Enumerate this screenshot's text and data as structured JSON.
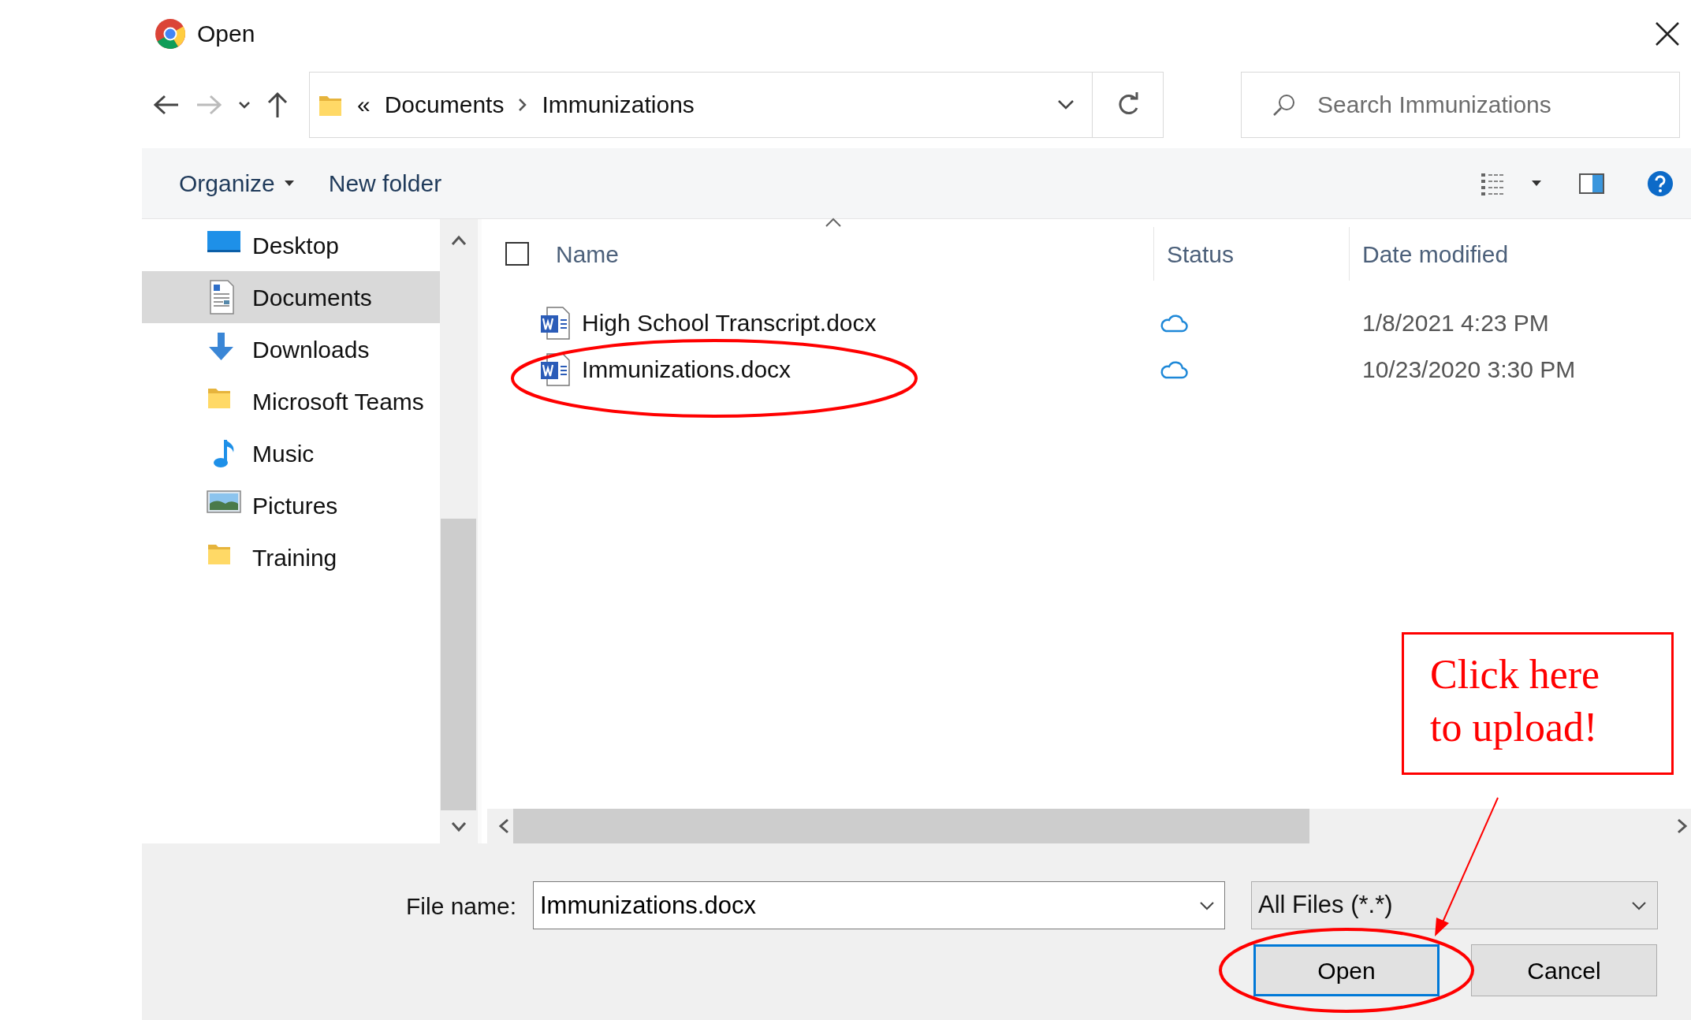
{
  "window": {
    "title": "Open"
  },
  "address": {
    "overflow": "«",
    "crumbs": [
      "Documents",
      "Immunizations"
    ]
  },
  "search": {
    "placeholder": "Search Immunizations"
  },
  "toolbar": {
    "organize": "Organize",
    "new_folder": "New folder"
  },
  "sidebar": {
    "items": [
      {
        "label": "Desktop",
        "selected": false
      },
      {
        "label": "Documents",
        "selected": true
      },
      {
        "label": "Downloads",
        "selected": false
      },
      {
        "label": "Microsoft Teams",
        "selected": false
      },
      {
        "label": "Music",
        "selected": false
      },
      {
        "label": "Pictures",
        "selected": false
      },
      {
        "label": "Training",
        "selected": false
      }
    ]
  },
  "table": {
    "select_all": {
      "checked": false
    },
    "columns": [
      "Name",
      "Status",
      "Date modified"
    ],
    "rows": [
      {
        "name": "High School Transcript.docx",
        "date": "1/8/2021 4:23 PM"
      },
      {
        "name": "Immunizations.docx",
        "date": "10/23/2020 3:30 PM"
      }
    ]
  },
  "file_name": {
    "label": "File name:",
    "value": "Immunizations.docx"
  },
  "file_type": {
    "value": "All Files (*.*)"
  },
  "buttons": [
    {
      "label": "Open",
      "default": true
    },
    {
      "label": "Cancel",
      "default": false
    }
  ],
  "annotation": {
    "lines": [
      "Click here",
      "to upload!"
    ]
  }
}
